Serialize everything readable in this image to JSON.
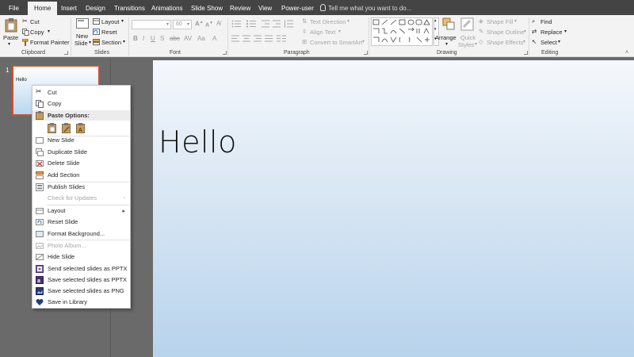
{
  "tabs": [
    {
      "label": "File",
      "active": false
    },
    {
      "label": "Home",
      "active": true
    },
    {
      "label": "Insert",
      "active": false
    },
    {
      "label": "Design",
      "active": false
    },
    {
      "label": "Transitions",
      "active": false
    },
    {
      "label": "Animations",
      "active": false
    },
    {
      "label": "Slide Show",
      "active": false
    },
    {
      "label": "Review",
      "active": false
    },
    {
      "label": "View",
      "active": false
    },
    {
      "label": "Power-user",
      "active": false
    }
  ],
  "tell_me": "Tell me what you want to do...",
  "ribbon": {
    "clipboard": {
      "paste": "Paste",
      "cut": "Cut",
      "copy": "Copy",
      "format_painter": "Format Painter",
      "label": "Clipboard"
    },
    "slides": {
      "new_slide_line1": "New",
      "new_slide_line2": "Slide",
      "layout": "Layout",
      "reset": "Reset",
      "section": "Section",
      "label": "Slides"
    },
    "font": {
      "size": "60",
      "label": "Font"
    },
    "paragraph": {
      "text_direction": "Text Direction",
      "align_text": "Align Text",
      "convert_smartart": "Convert to SmartArt",
      "label": "Paragraph"
    },
    "drawing": {
      "arrange": "Arrange",
      "quick_styles_line1": "Quick",
      "quick_styles_line2": "Styles",
      "shape_fill": "Shape Fill",
      "shape_outline": "Shape Outline",
      "shape_effects": "Shape Effects",
      "label": "Drawing"
    },
    "editing": {
      "find": "Find",
      "replace": "Replace",
      "select": "Select",
      "label": "Editing"
    }
  },
  "thumbnail": {
    "number": "1",
    "text": "Hello"
  },
  "slide": {
    "title": "Hello"
  },
  "context_menu": {
    "cut": "Cut",
    "copy": "Copy",
    "paste_options": "Paste Options:",
    "new_slide": "New Slide",
    "duplicate_slide": "Duplicate Slide",
    "delete_slide": "Delete Slide",
    "add_section": "Add Section",
    "publish_slides": "Publish Slides",
    "check_updates": "Check for Updates",
    "layout": "Layout",
    "reset_slide": "Reset Slide",
    "format_background": "Format Background...",
    "photo_album": "Photo Album...",
    "hide_slide": "Hide Slide",
    "send_pptx": "Send selected slides as PPTX",
    "save_pptx": "Save selected slides as PPTX",
    "save_png": "Save selected slides as PNG",
    "save_library": "Save in Library"
  },
  "colors": {
    "accent": "#d0502e",
    "tabbar": "#444444",
    "ribbon": "#f3f3f3",
    "workspace": "#6a6a6a"
  }
}
